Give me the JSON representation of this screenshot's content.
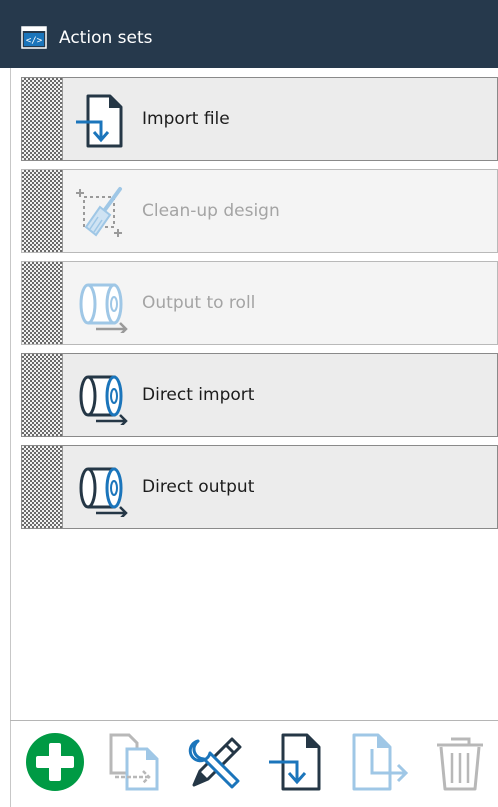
{
  "header": {
    "title": "Action sets",
    "icon": "code-window-icon"
  },
  "action_sets": [
    {
      "label": "Import file",
      "enabled": true,
      "icon": "import-file-icon"
    },
    {
      "label": "Clean-up design",
      "enabled": false,
      "icon": "clean-up-icon"
    },
    {
      "label": "Output to roll",
      "enabled": false,
      "icon": "roll-output-icon"
    },
    {
      "label": "Direct import",
      "enabled": true,
      "icon": "roll-output-icon"
    },
    {
      "label": "Direct output",
      "enabled": true,
      "icon": "roll-output-icon"
    }
  ],
  "toolbar": [
    {
      "name": "add",
      "icon": "plus-circle-icon",
      "enabled": true
    },
    {
      "name": "duplicate",
      "icon": "duplicate-icon",
      "enabled": false
    },
    {
      "name": "edit",
      "icon": "tools-icon",
      "enabled": true
    },
    {
      "name": "import",
      "icon": "import-file-icon",
      "enabled": true
    },
    {
      "name": "export",
      "icon": "export-file-icon",
      "enabled": false
    },
    {
      "name": "delete",
      "icon": "trash-icon",
      "enabled": false
    }
  ],
  "colors": {
    "header_bg": "#26394c",
    "accent_blue": "#1b75bb",
    "dark_navy": "#253746",
    "add_green": "#009a44"
  }
}
